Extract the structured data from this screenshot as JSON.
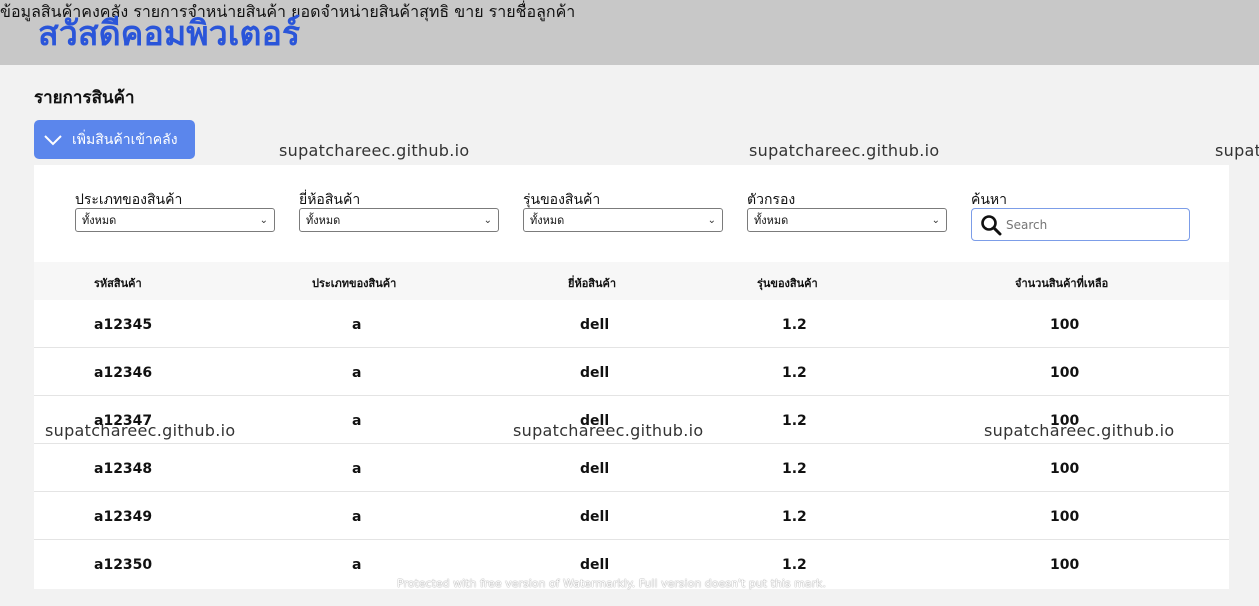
{
  "header": {
    "brand": "สวัสดีคอมพิวเตอร์",
    "nav": [
      "ข้อมูลสินค้าคงคลัง",
      "รายการจำหน่ายสินค้า",
      "ยอดจำหน่ายสินค้าสุทธิ",
      "ขาย",
      "รายชื่อลูกค้า"
    ]
  },
  "page": {
    "title": "รายการสินค้า",
    "add_button": "เพิ่มสินค้าเข้าคลัง"
  },
  "filters": [
    {
      "label": "ประเภทของสินค้า",
      "value": "ทั้งหมด"
    },
    {
      "label": "ยี่ห้อสินค้า",
      "value": "ทั้งหมด"
    },
    {
      "label": "รุ่นของสินค้า",
      "value": "ทั้งหมด"
    },
    {
      "label": "ตัวกรอง",
      "value": "ทั้งหมด"
    }
  ],
  "search": {
    "label": "ค้นหา",
    "placeholder": "Search"
  },
  "table": {
    "headers": [
      "รหัสสินค้า",
      "ประเภทของสินค้า",
      "ยี่ห้อสินค้า",
      "รุ่นของสินค้า",
      "จำนวนสินค้าที่เหลือ"
    ],
    "rows": [
      [
        "a12345",
        "a",
        "dell",
        "1.2",
        "100"
      ],
      [
        "a12346",
        "a",
        "dell",
        "1.2",
        "100"
      ],
      [
        "a12347",
        "a",
        "dell",
        "1.2",
        "100"
      ],
      [
        "a12348",
        "a",
        "dell",
        "1.2",
        "100"
      ],
      [
        "a12349",
        "a",
        "dell",
        "1.2",
        "100"
      ],
      [
        "a12350",
        "a",
        "dell",
        "1.2",
        "100"
      ]
    ]
  },
  "watermark": {
    "text": "supatchareec.github.io",
    "text_cut": "supat",
    "footer": "Protected with free version of Watermarkly. Full version doesn't put this mark."
  },
  "colors": {
    "brand": "#2a55d9",
    "button": "#5b86ec",
    "topbar": "#c8c8c8"
  }
}
